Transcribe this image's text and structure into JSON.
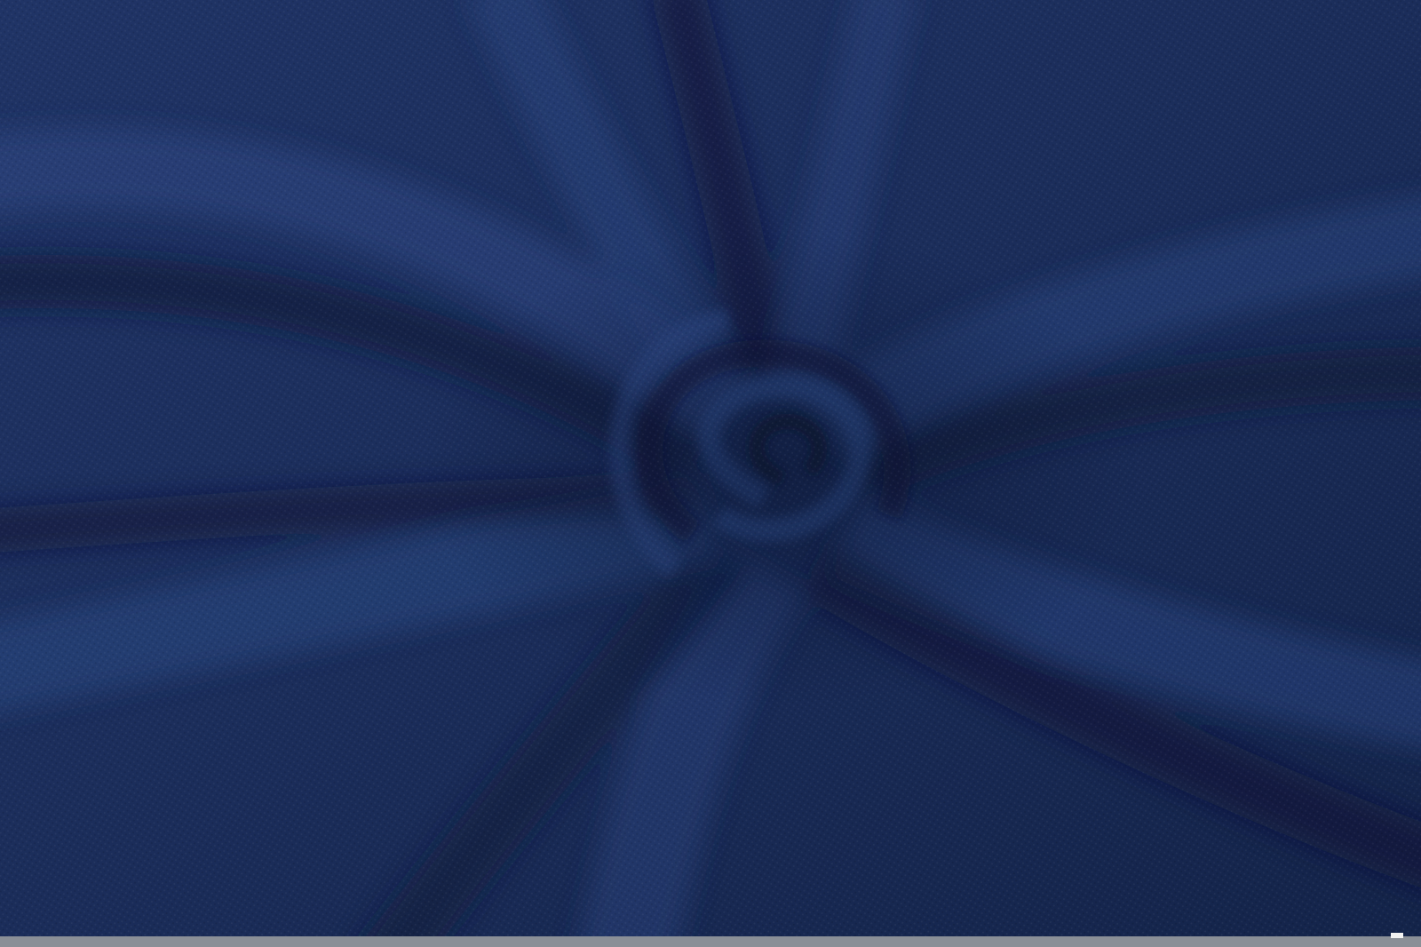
{
  "image": {
    "subject": "fabric-swirl",
    "colors": {
      "base": "#1c2f5e",
      "shadow": "#0d1a38",
      "highlight": "#2c4780",
      "strip": "#8a8f97"
    }
  }
}
